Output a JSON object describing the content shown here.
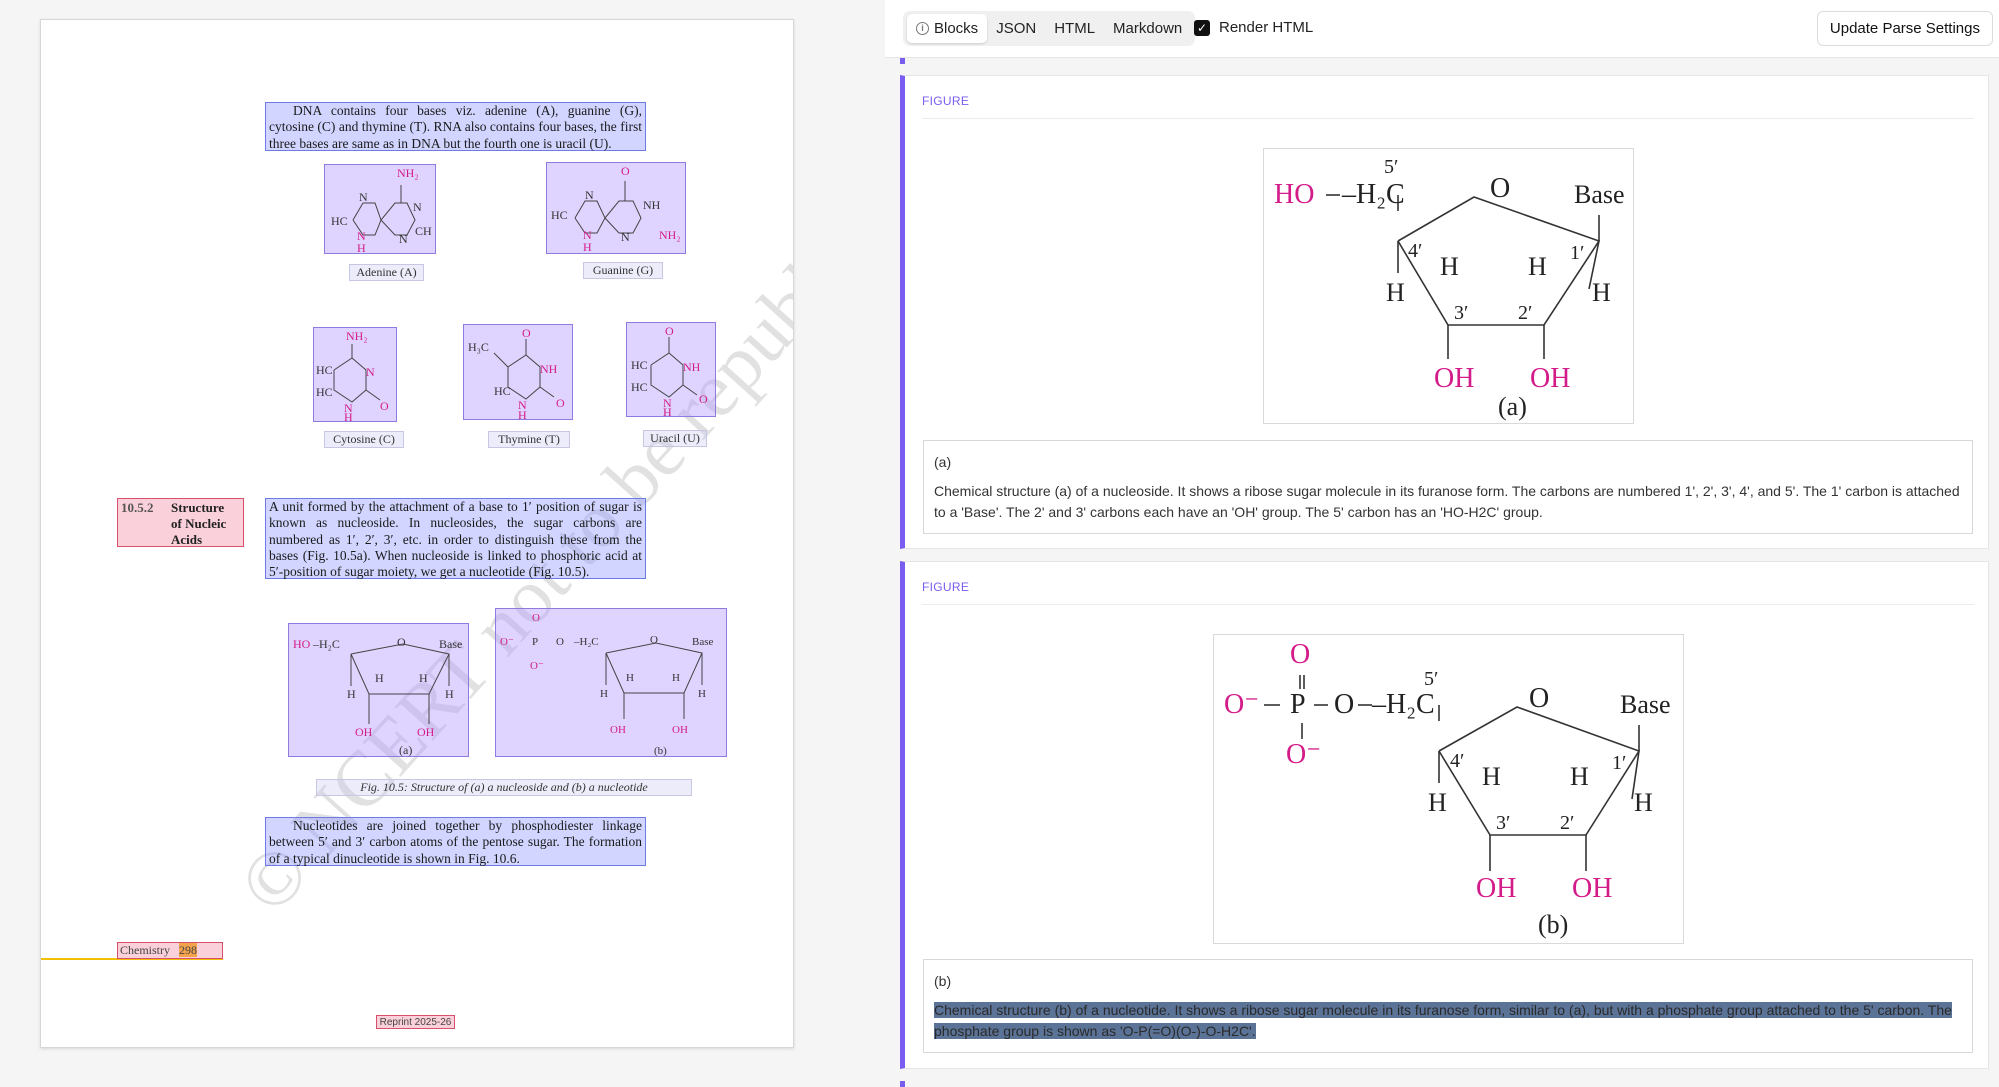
{
  "document": {
    "intro_paragraph": "DNA contains four bases viz. adenine (A), guanine (G), cytosine (C) and thymine (T). RNA also contains four bases, the first three bases are same as in DNA but the fourth one is uracil (U).",
    "bases": [
      {
        "caption": "Adenine (A)"
      },
      {
        "caption": "Guanine (G)"
      },
      {
        "caption": "Cytosine (C)"
      },
      {
        "caption": "Thymine (T)"
      },
      {
        "caption": "Uracil (U)"
      }
    ],
    "section_number": "10.5.2",
    "section_title": "Structure of Nucleic Acids",
    "section_title_line1": "Structure",
    "section_title_line2": "of Nucleic",
    "section_title_line3": "Acids",
    "nucleoside_paragraph": "A unit formed by the attachment of a base to 1′ position of sugar is known as nucleoside. In nucleosides, the sugar carbons are numbered as 1′, 2′, 3′, etc. in order to distinguish these from the bases (Fig. 10.5a). When nucleoside is linked to phosphoric acid at 5′-position of sugar moiety, we get a nucleotide (Fig. 10.5).",
    "fig_caption": "Fig. 10.5: Structure of (a) a nucleoside and (b) a nucleotide",
    "nucleotide_paragraph": "Nucleotides are joined together by phosphodiester linkage between 5′ and 3′ carbon atoms of the pentose sugar. The formation of a typical dinucleotide is shown in Fig. 10.6.",
    "footer_subject": "Chemistry",
    "footer_page": "298",
    "reprint": "Reprint 2025-26",
    "watermark": "© NCERT not to be republished"
  },
  "toolbar": {
    "tabs": [
      {
        "label": "Blocks",
        "active": true,
        "icon": "info-icon"
      },
      {
        "label": "JSON"
      },
      {
        "label": "HTML"
      },
      {
        "label": "Markdown"
      }
    ],
    "render_html_label": "Render HTML",
    "render_html_checked": true,
    "update_button": "Update Parse Settings"
  },
  "cards": [
    {
      "type_label": "FIGURE",
      "figure_label": "(a)",
      "caption_title": "(a)",
      "caption_text": "Chemical structure (a) of a nucleoside. It shows a ribose sugar molecule in its furanose form. The carbons are numbered 1', 2', 3', 4', and 5'. The 1' carbon is attached to a 'Base'. The 2' and 3' carbons each have an 'OH' group. The 5' carbon has an 'HO-H2C' group."
    },
    {
      "type_label": "FIGURE",
      "figure_label": "(b)",
      "caption_title": "(b)",
      "caption_text": "Chemical structure (b) of a nucleotide. It shows a ribose sugar molecule in its furanose form, similar to (a), but with a phosphate group attached to the 5' carbon. The phosphate group is shown as 'O-P(=O)(O-)-O-H2C'."
    }
  ],
  "chem": {
    "ho": "HO",
    "h2c": "–H₂C",
    "o": "O",
    "base": "Base",
    "h": "H",
    "oh": "OH",
    "p": "P",
    "o_minus": "O⁻",
    "c5": "5′",
    "c4": "4′",
    "c3": "3′",
    "c2": "2′",
    "c1": "1′",
    "nh2": "NH₂",
    "nh": "NH",
    "hc": "HC",
    "n": "N",
    "ch": "CH",
    "c": "C",
    "h3c": "H₃C"
  },
  "colors": {
    "accent": "#7b5cf0",
    "chem_pink": "#d41b8a",
    "block_blue": "#6c7be6",
    "highlight": "#5b7396"
  }
}
